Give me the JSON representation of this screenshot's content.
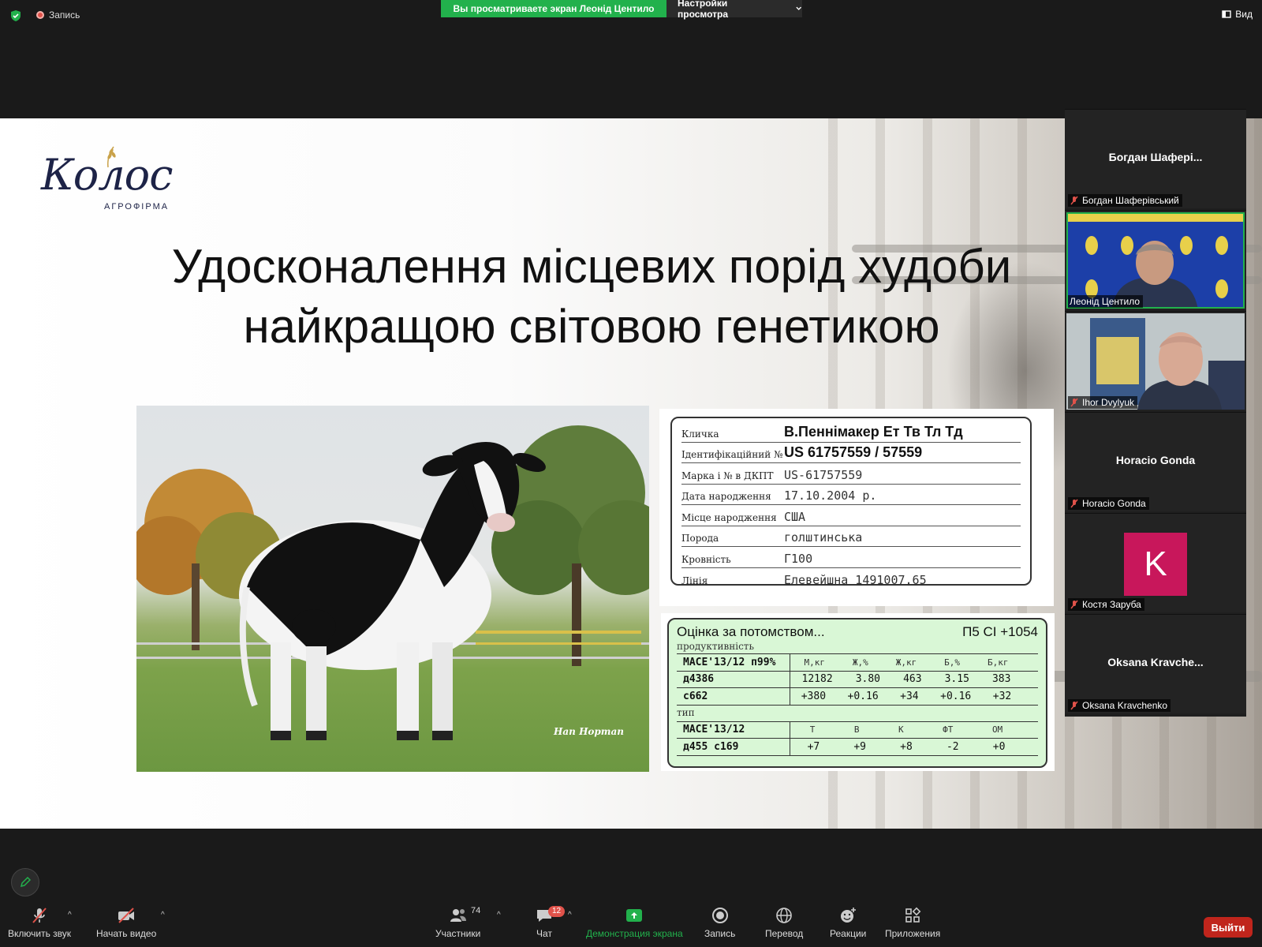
{
  "topbar": {
    "recording_label": "Запись",
    "viewing_banner": "Вы просматриваете экран Леонід Центило",
    "view_settings": "Настройки просмотра",
    "view_button": "Вид"
  },
  "slide": {
    "logo_text": "Колос",
    "logo_subtitle": "АГРОФІРМА",
    "title_line1": "Удосконалення місцевих порід худоби",
    "title_line2": "найкращою світовою генетикою",
    "photo_credit": "Han Hopman",
    "card1": {
      "rows": [
        {
          "label": "Кличка",
          "value": "В.Пеннімакер Ет Тв Тл Тд",
          "bold": true
        },
        {
          "label": "Ідентифікаційний №",
          "value": "US 61757559 / 57559",
          "bold": true
        },
        {
          "label": "Марка і № в ДКПТ",
          "value": "US-61757559",
          "bold": false
        },
        {
          "label": "Дата народження",
          "value": "17.10.2004 р.",
          "bold": false
        },
        {
          "label": "Місце народження",
          "value": "США",
          "bold": false
        },
        {
          "label": "Порода",
          "value": "голштинська",
          "bold": false
        },
        {
          "label": "Кровність",
          "value": "Г100",
          "bold": false
        },
        {
          "label": "Лінія",
          "value": "Елевейшна 1491007.65",
          "bold": false
        }
      ]
    },
    "card2": {
      "title": "Оцінка за потомством...",
      "index": "П5  СІ +1054",
      "subtitle": "продуктивність",
      "prod_header": {
        "left": "МАСЕ'13/12 п99%",
        "cols": [
          "М,кг",
          "Ж,%",
          "Ж,кг",
          "Б,%",
          "Б,кг"
        ]
      },
      "prod_rows": [
        {
          "left": "д4386",
          "cols": [
            "12182",
            "3.80",
            "463",
            "3.15",
            "383"
          ]
        },
        {
          "left": "с662",
          "cols": [
            "+380",
            "+0.16",
            "+34",
            "+0.16",
            "+32"
          ]
        }
      ],
      "type_label": "тип",
      "type_header": {
        "left": "МАСЕ'13/12",
        "cols": [
          "Т",
          "В",
          "К",
          "ФТ",
          "ОМ"
        ]
      },
      "type_rows": [
        {
          "left": "д455 с169",
          "cols": [
            "+7",
            "+9",
            "+8",
            "-2",
            "+0"
          ]
        }
      ]
    }
  },
  "gallery": {
    "tiles": [
      {
        "name": "Богдан  Шафері...",
        "label": "Богдан Шаферівський",
        "type": "name"
      },
      {
        "name": "",
        "label": "Леонід Центило",
        "type": "video"
      },
      {
        "name": "",
        "label": "Ihor Dvylyuk",
        "type": "video"
      },
      {
        "name": "Horacio Gonda",
        "label": "Horacio Gonda",
        "type": "name"
      },
      {
        "name": "K",
        "label": "Костя Заруба",
        "type": "avatar"
      },
      {
        "name": "Oksana  Kravche...",
        "label": "Oksana Kravchenko",
        "type": "name"
      }
    ]
  },
  "toolbar": {
    "unmute": "Включить звук",
    "start_video": "Начать видео",
    "participants": "Участники",
    "participants_count": "74",
    "chat": "Чат",
    "chat_badge": "12",
    "share": "Демонстрация экрана",
    "record": "Запись",
    "translate": "Перевод",
    "reactions": "Реакции",
    "apps": "Приложения",
    "leave": "Выйти"
  },
  "colors": {
    "green": "#22b14c",
    "leave_red": "#c0251c",
    "avatar_magenta": "#c8175b",
    "slide_title": "#111111"
  },
  "icons": [
    "shield-icon",
    "record-icon",
    "view-icon",
    "mic-muted-icon",
    "video-off-icon",
    "participants-icon",
    "chat-icon",
    "share-screen-icon",
    "record-button-icon",
    "globe-icon",
    "reaction-icon",
    "apps-icon",
    "pencil-icon"
  ]
}
